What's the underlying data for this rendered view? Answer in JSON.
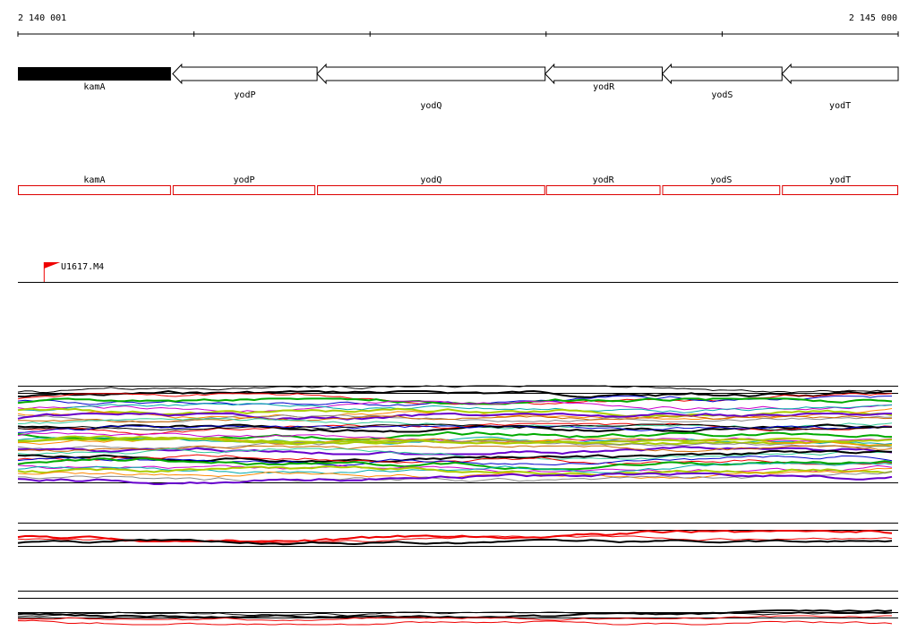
{
  "ruler": {
    "start_label": "2 140 001",
    "end_label": "2 145 000",
    "start": 2140001,
    "end": 2145000
  },
  "genes": [
    {
      "name": "kamA",
      "strand": "+",
      "start": 2140001,
      "end": 2140870,
      "color": "#000000"
    },
    {
      "name": "yodP",
      "strand": "-",
      "start": 2140880,
      "end": 2141700,
      "color": "#000000"
    },
    {
      "name": "yodQ",
      "strand": "-",
      "start": 2141700,
      "end": 2142995,
      "color": "#000000"
    },
    {
      "name": "yodR",
      "strand": "-",
      "start": 2142995,
      "end": 2143660,
      "color": "#000000"
    },
    {
      "name": "yodS",
      "strand": "-",
      "start": 2143660,
      "end": 2144340,
      "color": "#000000"
    },
    {
      "name": "yodT",
      "strand": "-",
      "start": 2144340,
      "end": 2145000,
      "color": "#000000"
    }
  ],
  "feature_boxes": [
    {
      "name": "kamA",
      "start": 2140001,
      "end": 2140870
    },
    {
      "name": "yodP",
      "start": 2140880,
      "end": 2141690
    },
    {
      "name": "yodQ",
      "start": 2141700,
      "end": 2142995
    },
    {
      "name": "yodR",
      "start": 2143000,
      "end": 2143650
    },
    {
      "name": "yodS",
      "start": 2143660,
      "end": 2144330
    },
    {
      "name": "yodT",
      "start": 2144340,
      "end": 2145000
    }
  ],
  "feature_box_color": "#dd0000",
  "marker": {
    "label": "U1617.M4",
    "position": 2140150,
    "color": "#ee0000"
  },
  "expression_colors": [
    "#000000",
    "#ee0000",
    "#0000cc",
    "#00aa00",
    "#cc00cc",
    "#00aaaa",
    "#aacc00",
    "#ff8800",
    "#888888",
    "#6600cc",
    "#cc6600",
    "#33cc99"
  ]
}
